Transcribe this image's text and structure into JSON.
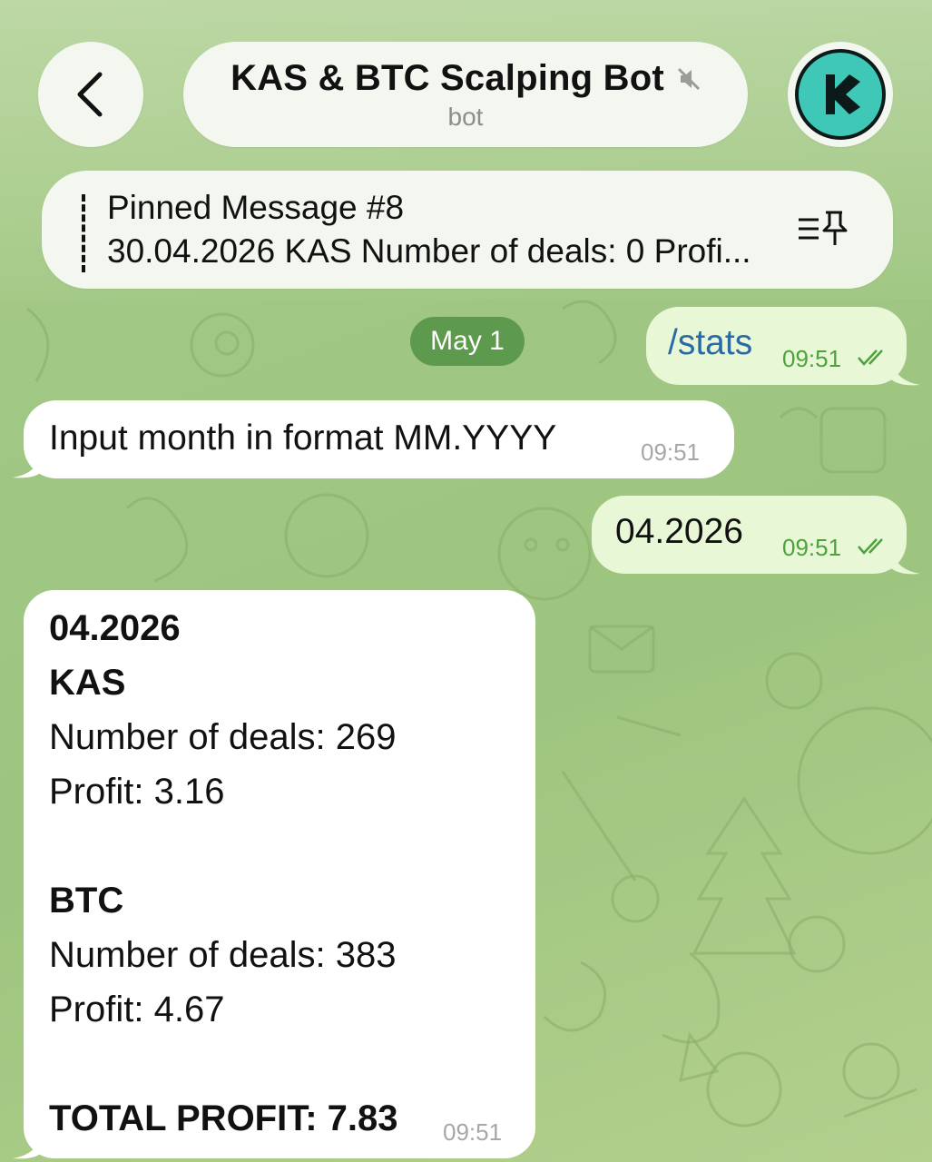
{
  "header": {
    "title": "KAS & BTC Scalping Bot",
    "subtitle": "bot",
    "muted_icon": "muted-speaker-icon",
    "back_icon": "chevron-left-icon",
    "avatar_icon": "kaspa-logo-icon"
  },
  "pinned": {
    "title": "Pinned Message #8",
    "text": "30.04.2026 KAS Number of deals: 0 Profi...",
    "icon": "pinned-list-icon"
  },
  "date_divider": "May 1",
  "messages": [
    {
      "direction": "out",
      "text": "/stats",
      "time": "09:51",
      "status": "read"
    },
    {
      "direction": "in",
      "text": "Input month in format MM.YYYY",
      "time": "09:51"
    },
    {
      "direction": "out",
      "text": "04.2026",
      "time": "09:51",
      "status": "read"
    },
    {
      "direction": "in",
      "lines": {
        "month": "04.2026",
        "kas_header": "KAS",
        "kas_deals": "Number of deals: 269",
        "kas_profit": "Profit: 3.16",
        "btc_header": "BTC",
        "btc_deals": "Number of deals: 383",
        "btc_profit": "Profit: 4.67",
        "total": "TOTAL PROFIT: 7.83"
      },
      "time": "09:51"
    }
  ],
  "colors": {
    "outgoing_bubble": "#e8f8d6",
    "incoming_bubble": "#ffffff",
    "date_chip": "#5e9a4d",
    "time_outgoing": "#4da23b",
    "link_command": "#2a6aa6",
    "avatar": "#3fc7b8"
  }
}
